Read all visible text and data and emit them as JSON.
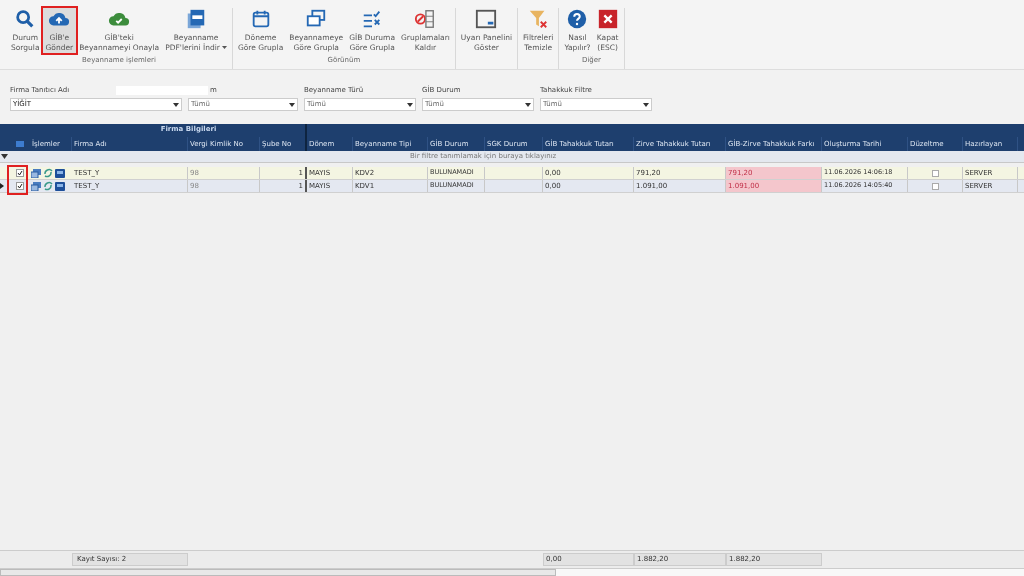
{
  "toolbar": {
    "groups": [
      {
        "label": "Beyanname işlemleri",
        "buttons": [
          {
            "kind": "search",
            "lines": [
              "Durum",
              "Sorgula"
            ],
            "highlighted": false,
            "dropdown": false
          },
          {
            "kind": "cloud-upload",
            "lines": [
              "GİB'e",
              "Gönder"
            ],
            "highlighted": true,
            "dropdown": false
          },
          {
            "kind": "cloud-check",
            "lines": [
              "GİB'teki",
              "Beyannameyi Onayla"
            ],
            "highlighted": false,
            "dropdown": false
          },
          {
            "kind": "pdf",
            "lines": [
              "Beyanname",
              "PDF'lerini İndir"
            ],
            "highlighted": false,
            "dropdown": true
          }
        ]
      },
      {
        "label": "Görünüm",
        "buttons": [
          {
            "kind": "calendar",
            "lines": [
              "Döneme",
              "Göre Grupla"
            ],
            "highlighted": false,
            "dropdown": false
          },
          {
            "kind": "copy",
            "lines": [
              "Beyannameye",
              "Göre Grupla"
            ],
            "highlighted": false,
            "dropdown": false
          },
          {
            "kind": "list-check",
            "lines": [
              "GİB Duruma",
              "Göre Grupla"
            ],
            "highlighted": false,
            "dropdown": false
          },
          {
            "kind": "ungroup",
            "lines": [
              "Gruplamaları",
              "Kaldır"
            ],
            "highlighted": false,
            "dropdown": false
          }
        ]
      },
      {
        "buttons": [
          {
            "kind": "panel",
            "lines": [
              "Uyarı Panelini",
              "Göster"
            ],
            "highlighted": false,
            "dropdown": false
          }
        ]
      },
      {
        "buttons": [
          {
            "kind": "filter-clear",
            "lines": [
              "Filtreleri",
              "Temizle"
            ],
            "highlighted": false,
            "dropdown": false
          }
        ]
      },
      {
        "label": "Diğer",
        "buttons": [
          {
            "kind": "help",
            "lines": [
              "Nasıl",
              "Yapılır?"
            ],
            "highlighted": false,
            "dropdown": false
          },
          {
            "kind": "close",
            "lines": [
              "Kapat",
              "(ESC)"
            ],
            "highlighted": false,
            "dropdown": false
          }
        ]
      }
    ]
  },
  "filters": [
    {
      "label": "Firma Tanıtıcı Adı",
      "value": "YİĞİT",
      "redacted": false
    },
    {
      "label": "m",
      "value": "Tümü",
      "redacted": true
    },
    {
      "label": "Beyanname Türü",
      "value": "Tümü",
      "redacted": false
    },
    {
      "label": "GİB Durum",
      "value": "Tümü",
      "redacted": false
    },
    {
      "label": "Tahakkuk Filtre",
      "value": "Tümü",
      "redacted": false
    }
  ],
  "grid": {
    "band": "Firma Bilgileri",
    "columns": [
      "İşlemler",
      "Firma Adı",
      "Vergi Kimlik No",
      "Şube No",
      "Dönem",
      "Beyanname Tipi",
      "GİB Durum",
      "SGK Durum",
      "GİB Tahakkuk Tutarı",
      "Zirve Tahakkuk Tutarı",
      "GİB-Zirve Tahakkuk Farkı",
      "Oluşturma Tarihi",
      "Düzeltme",
      "Hazırlayan"
    ],
    "filter_hint": "Bir filtre tanımlamak için buraya tıklayınız",
    "checkboxes_highlighted": true,
    "rows": [
      {
        "checked": true,
        "current": false,
        "firma": "TEST_Y",
        "vkn": "98",
        "sube": "1",
        "donem": "MAYIS",
        "tip": "KDV2",
        "gib_durum": "BULUNAMADI",
        "gib_tutar": "0,00",
        "zirve_tutar": "791,20",
        "fark": "791,20",
        "tarih": "11.06.2026 14:06:18",
        "duzeltme": false,
        "hazirlayan": "SERVER"
      },
      {
        "checked": true,
        "current": true,
        "firma": "TEST_Y",
        "vkn": "98",
        "sube": "1",
        "donem": "MAYIS",
        "tip": "KDV1",
        "gib_durum": "BULUNAMADI",
        "gib_tutar": "0,00",
        "zirve_tutar": "1.091,00",
        "fark": "1.091,00",
        "tarih": "11.06.2026 14:05:40",
        "duzeltme": false,
        "hazirlayan": "SERVER"
      }
    ],
    "footer": {
      "count": "Kayıt Sayısı: 2",
      "gib_tutar": "0,00",
      "zirve_tutar": "1.882,20",
      "fark": "1.882,20"
    }
  }
}
